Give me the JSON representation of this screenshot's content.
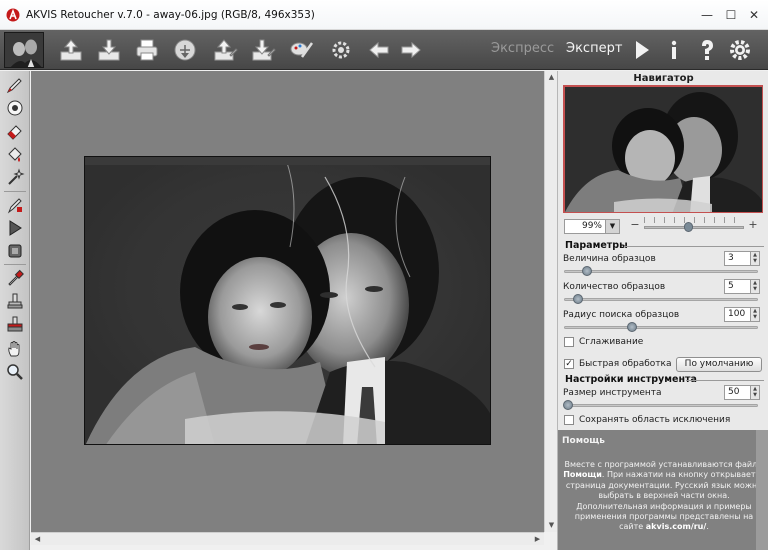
{
  "window": {
    "title": "AKVIS Retoucher v.7.0 - away-06.jpg (RGB/8, 496x353)",
    "minimize_glyph": "—",
    "maximize_glyph": "☐",
    "close_glyph": "✕"
  },
  "toolbar": {
    "buttons": [
      "open-icon",
      "save-icon",
      "print-icon",
      "share-icon",
      "import-presets-icon",
      "export-presets-icon",
      "batch-icon",
      "preferences-icon",
      "undo-icon",
      "redo-icon"
    ],
    "mode_express": "Экспресс",
    "mode_expert": "Эксперт",
    "right_buttons": [
      "run-icon",
      "info-icon",
      "help-icon",
      "settings-icon"
    ]
  },
  "tools": [
    "retouch-brush-icon",
    "stamp-icon",
    "eraser-icon",
    "fill-icon",
    "magic-wand-icon",
    "patch-icon",
    "selection-arrow-icon",
    "crop-icon",
    "eyedropper-icon",
    "clone-icon",
    "smudge-icon",
    "hand-icon",
    "zoom-icon"
  ],
  "navigator": {
    "title": "Навигатор",
    "zoom": "99%",
    "zoom_minus": "−",
    "zoom_plus": "+",
    "zoom_slider_fraction": 0.45
  },
  "params": {
    "title": "Параметры",
    "sample_size_label": "Величина образцов",
    "sample_size": "3",
    "sample_size_fraction": 0.12,
    "sample_count_label": "Количество образцов",
    "sample_count": "5",
    "sample_count_fraction": 0.07,
    "search_radius_label": "Радиус поиска образцов",
    "search_radius": "100",
    "search_radius_fraction": 0.35,
    "smoothing_label": "Сглаживание",
    "smoothing_checked": false,
    "fast_label": "Быстрая обработка",
    "fast_checked": true,
    "default_button": "По умолчанию"
  },
  "tool_settings": {
    "title": "Настройки инструмента",
    "size_label": "Размер инструмента",
    "size": "50",
    "size_fraction": 0.02,
    "save_exclusion_label": "Сохранять область исключения",
    "save_exclusion_checked": false
  },
  "help": {
    "title": "Помощь",
    "text_1": "Вместе с программой устанавливаются файлы",
    "text_bold_1": "Помощи",
    "text_2": ". При нажатии на кнопку открывается страница документации. Русский язык можно выбрать в верхней части окна. Дополнительная информация и примеры применения программы представлены на сайте",
    "text_bold_2": "akvis.com/ru/",
    "text_3": "."
  },
  "colors": {
    "accent": "#c41a1a",
    "toolbar_bg": "#575757",
    "canvas_bg": "#808080",
    "help_bg": "#818181"
  }
}
